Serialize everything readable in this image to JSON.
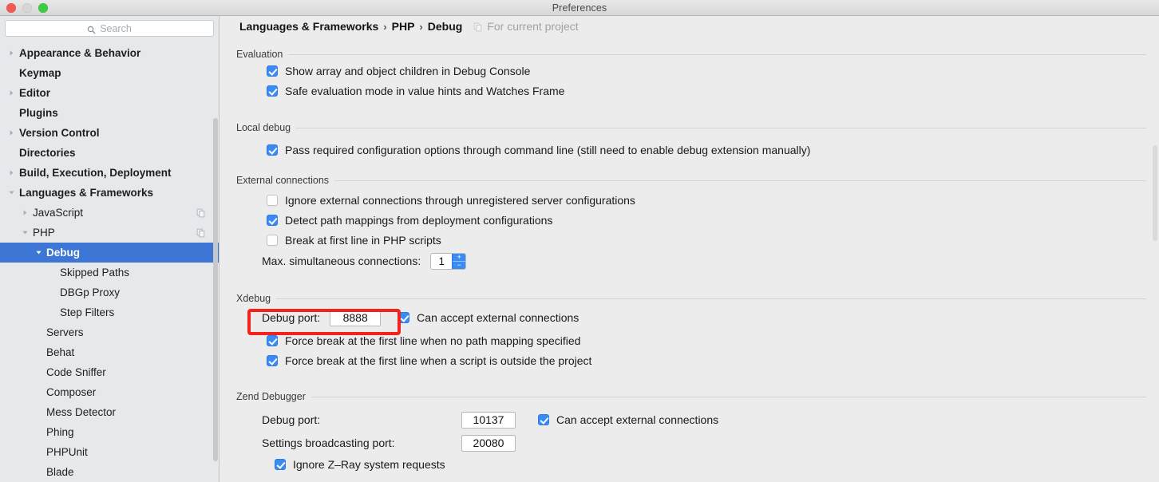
{
  "window": {
    "title": "Preferences",
    "traffic_lights": [
      "close-button",
      "minimize-button",
      "zoom-button"
    ]
  },
  "sidebar": {
    "search": {
      "placeholder": "Search",
      "value": "",
      "icon": "search-icon"
    },
    "items": [
      {
        "label": "Appearance & Behavior",
        "level": 0,
        "bold": true,
        "twisty": "collapsed",
        "selected": false,
        "badge": false
      },
      {
        "label": "Keymap",
        "level": 0,
        "bold": true,
        "twisty": "none",
        "selected": false,
        "badge": false
      },
      {
        "label": "Editor",
        "level": 0,
        "bold": true,
        "twisty": "collapsed",
        "selected": false,
        "badge": false
      },
      {
        "label": "Plugins",
        "level": 0,
        "bold": true,
        "twisty": "none",
        "selected": false,
        "badge": false
      },
      {
        "label": "Version Control",
        "level": 0,
        "bold": true,
        "twisty": "collapsed",
        "selected": false,
        "badge": false
      },
      {
        "label": "Directories",
        "level": 0,
        "bold": true,
        "twisty": "none",
        "selected": false,
        "badge": false
      },
      {
        "label": "Build, Execution, Deployment",
        "level": 0,
        "bold": true,
        "twisty": "collapsed",
        "selected": false,
        "badge": false
      },
      {
        "label": "Languages & Frameworks",
        "level": 0,
        "bold": true,
        "twisty": "expanded",
        "selected": false,
        "badge": false
      },
      {
        "label": "JavaScript",
        "level": 1,
        "bold": false,
        "twisty": "collapsed",
        "selected": false,
        "badge": true
      },
      {
        "label": "PHP",
        "level": 1,
        "bold": false,
        "twisty": "expanded",
        "selected": false,
        "badge": true
      },
      {
        "label": "Debug",
        "level": 2,
        "bold": true,
        "twisty": "expanded",
        "selected": true,
        "badge": false
      },
      {
        "label": "Skipped Paths",
        "level": 3,
        "bold": false,
        "twisty": "none",
        "selected": false,
        "badge": false
      },
      {
        "label": "DBGp Proxy",
        "level": 3,
        "bold": false,
        "twisty": "none",
        "selected": false,
        "badge": false
      },
      {
        "label": "Step Filters",
        "level": 3,
        "bold": false,
        "twisty": "none",
        "selected": false,
        "badge": false
      },
      {
        "label": "Servers",
        "level": 2,
        "bold": false,
        "twisty": "none",
        "selected": false,
        "badge": false
      },
      {
        "label": "Behat",
        "level": 2,
        "bold": false,
        "twisty": "none",
        "selected": false,
        "badge": false
      },
      {
        "label": "Code Sniffer",
        "level": 2,
        "bold": false,
        "twisty": "none",
        "selected": false,
        "badge": false
      },
      {
        "label": "Composer",
        "level": 2,
        "bold": false,
        "twisty": "none",
        "selected": false,
        "badge": false
      },
      {
        "label": "Mess Detector",
        "level": 2,
        "bold": false,
        "twisty": "none",
        "selected": false,
        "badge": false
      },
      {
        "label": "Phing",
        "level": 2,
        "bold": false,
        "twisty": "none",
        "selected": false,
        "badge": false
      },
      {
        "label": "PHPUnit",
        "level": 2,
        "bold": false,
        "twisty": "none",
        "selected": false,
        "badge": false
      },
      {
        "label": "Blade",
        "level": 2,
        "bold": false,
        "twisty": "none",
        "selected": false,
        "badge": false
      }
    ]
  },
  "breadcrumb": {
    "crumbs": [
      "Languages & Frameworks",
      "PHP",
      "Debug"
    ],
    "separator": "›",
    "scope_text": "For current project",
    "scope_icon": "copy-pages-icon"
  },
  "sections": {
    "evaluation": {
      "title": "Evaluation",
      "options": [
        {
          "label": "Show array and object children in Debug Console",
          "checked": true
        },
        {
          "label": "Safe evaluation mode in value hints and Watches Frame",
          "checked": true
        }
      ]
    },
    "local_debug": {
      "title": "Local debug",
      "options": [
        {
          "label": "Pass required configuration options through command line (still need to enable debug extension manually)",
          "checked": true
        }
      ]
    },
    "external_connections": {
      "title": "External connections",
      "options": [
        {
          "label": "Ignore external connections through unregistered server configurations",
          "checked": false
        },
        {
          "label": "Detect path mappings from deployment configurations",
          "checked": true
        },
        {
          "label": "Break at first line in PHP scripts",
          "checked": false
        }
      ],
      "max_connections_label": "Max. simultaneous connections:",
      "max_connections_value": "1",
      "stepper_up": "+",
      "stepper_down": "−"
    },
    "xdebug": {
      "title": "Xdebug",
      "debug_port_label": "Debug port:",
      "debug_port_value": "8888",
      "accept_external_label": "Can accept external connections",
      "accept_external_checked": true,
      "options": [
        {
          "label": "Force break at the first line when no path mapping specified",
          "checked": true
        },
        {
          "label": "Force break at the first line when a script is outside the project",
          "checked": true
        }
      ],
      "highlight_color": "#f3231c"
    },
    "zend_debugger": {
      "title": "Zend Debugger",
      "debug_port_label": "Debug port:",
      "debug_port_value": "10137",
      "accept_external_label": "Can accept external connections",
      "accept_external_checked": true,
      "broadcast_label": "Settings broadcasting port:",
      "broadcast_value": "20080",
      "ignore_zray_label": "Ignore Z–Ray system requests",
      "ignore_zray_checked": true
    }
  },
  "colors": {
    "selection_blue": "#3d76d4",
    "checkbox_blue": "#3b8bf5",
    "highlight_red": "#f3231c",
    "sidebar_bg": "#e5e9ec",
    "panel_bg": "#ececec"
  }
}
